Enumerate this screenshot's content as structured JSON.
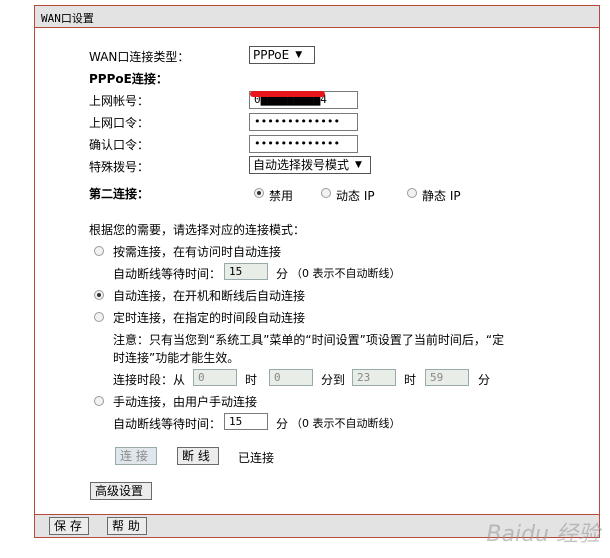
{
  "title": "WAN口设置",
  "wan_type": {
    "label": "WAN口连接类型：",
    "value": "PPPoE"
  },
  "pppoe_header": "PPPoE连接：",
  "account": {
    "label": "上网帐号：",
    "value": "0█████████4"
  },
  "password": {
    "label": "上网口令：",
    "value": "•••••••••••••"
  },
  "confirm": {
    "label": "确认口令：",
    "value": "•••••••••••••"
  },
  "special_dial": {
    "label": "特殊拨号：",
    "value": "自动选择拨号模式"
  },
  "secondary": {
    "label": "第二连接：",
    "options": [
      "禁用",
      "动态 IP",
      "静态 IP"
    ],
    "selected": "禁用"
  },
  "mode_prompt": "根据您的需要，请选择对应的连接模式：",
  "modes": {
    "on_demand": "按需连接，在有访问时自动连接",
    "auto": "自动连接，在开机和断线后自动连接",
    "timed": "定时连接，在指定的时间段自动连接",
    "manual": "手动连接，由用户手动连接",
    "selected": "auto"
  },
  "idle1": {
    "label": "自动断线等待时间：",
    "value": "15",
    "unit": "分",
    "hint": "（0 表示不自动断线）"
  },
  "note_line1": "注意：只有当您到“系统工具”菜单的“时间设置”项设置了当前时间后，“定",
  "note_line2": "时连接”功能才能生效。",
  "schedule": {
    "label": "连接时段：从",
    "from_h": "0",
    "h1": "时",
    "from_m": "0",
    "to": "分到",
    "to_h": "23",
    "h2": "时",
    "to_m": "59",
    "m2": "分"
  },
  "idle2": {
    "label": "自动断线等待时间：",
    "value": "15",
    "unit": "分",
    "hint": "（0 表示不自动断线）"
  },
  "buttons": {
    "connect": "连 接",
    "disconnect": "断 线",
    "status": "已连接",
    "advanced": "高级设置",
    "save": "保 存",
    "help": "帮 助"
  },
  "watermark": "Baidu 经验"
}
